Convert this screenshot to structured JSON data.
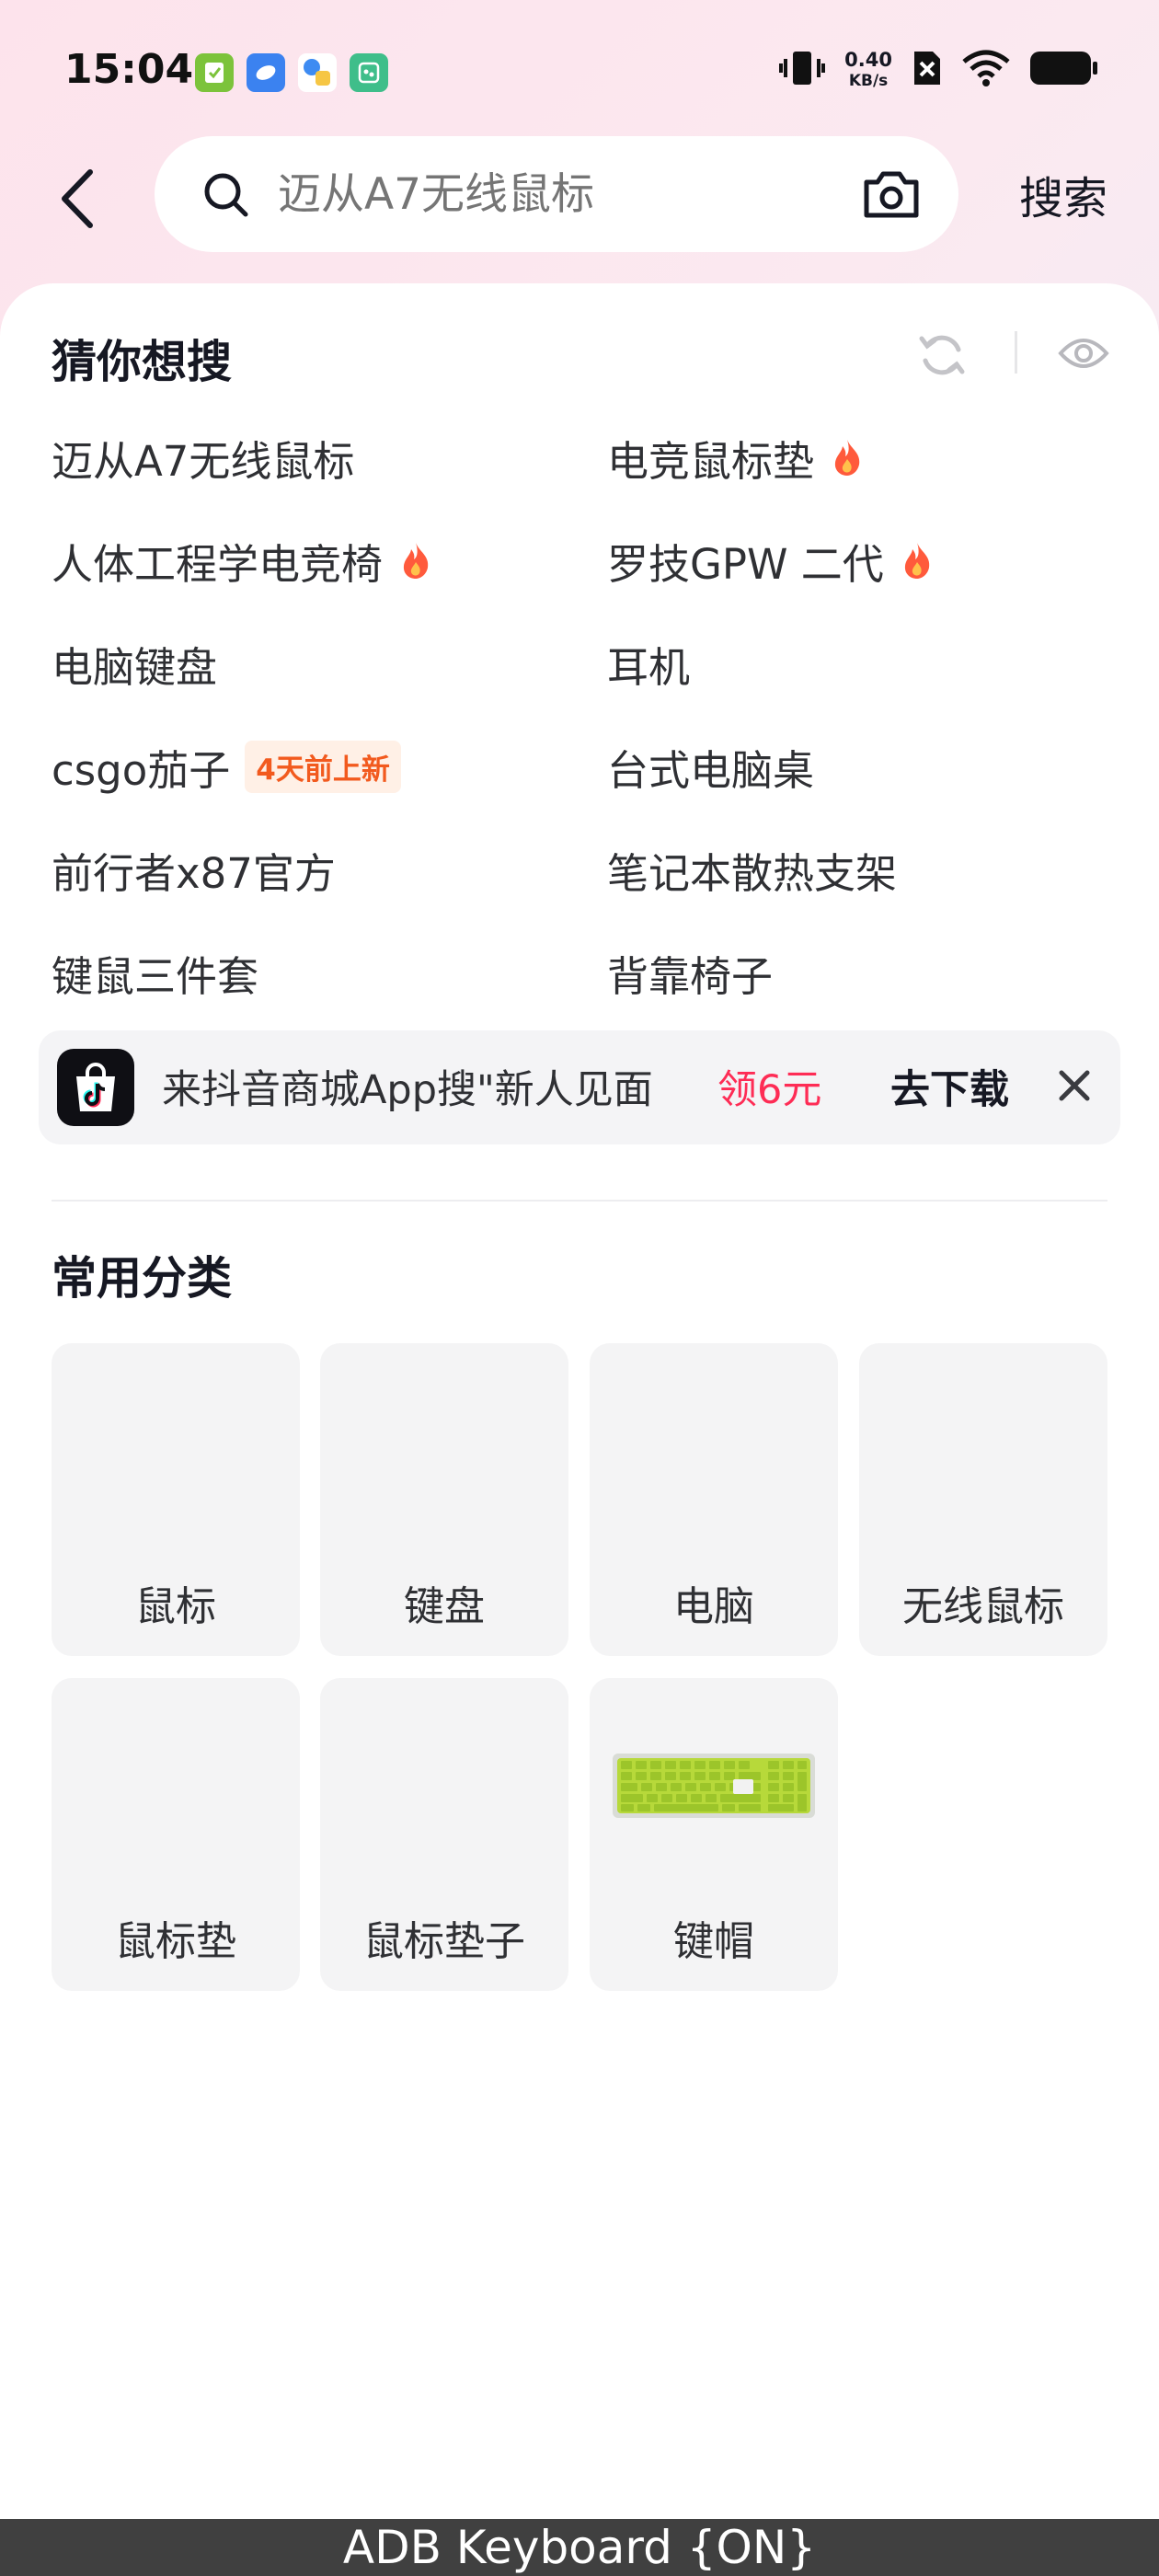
{
  "status_bar": {
    "time": "15:04",
    "net_speed_value": "0.40",
    "net_speed_unit": "KB/s"
  },
  "search": {
    "placeholder": "迈从A7无线鼠标",
    "submit_label": "搜索"
  },
  "suggestions": {
    "title": "猜你想搜",
    "items": [
      {
        "label": "迈从A7无线鼠标"
      },
      {
        "label": "电竞鼠标垫",
        "hot": true
      },
      {
        "label": "人体工程学电竞椅",
        "hot": true
      },
      {
        "label": "罗技GPW 二代",
        "hot": true
      },
      {
        "label": "电脑键盘"
      },
      {
        "label": "耳机"
      },
      {
        "label": "csgo茄子",
        "badge": "4天前上新"
      },
      {
        "label": "台式电脑桌"
      },
      {
        "label": "前行者x87官方"
      },
      {
        "label": "笔记本散热支架"
      },
      {
        "label": "键鼠三件套"
      },
      {
        "label": "背靠椅子"
      }
    ]
  },
  "promo": {
    "text": "来抖音商城App搜\"新人见面",
    "highlight": "领6元",
    "action": "去下载"
  },
  "categories": {
    "title": "常用分类",
    "items": [
      {
        "label": "鼠标"
      },
      {
        "label": "键盘"
      },
      {
        "label": "电脑"
      },
      {
        "label": "无线鼠标"
      },
      {
        "label": "鼠标垫"
      },
      {
        "label": "鼠标垫子"
      },
      {
        "label": "键帽",
        "image": "green-keycap-keyboard"
      }
    ]
  },
  "ime_bar": {
    "label": "ADB Keyboard {ON}"
  },
  "colors": {
    "accent_red": "#fe2c55",
    "badge_orange": "#f25a1e",
    "fire": "#ff5a3c"
  }
}
